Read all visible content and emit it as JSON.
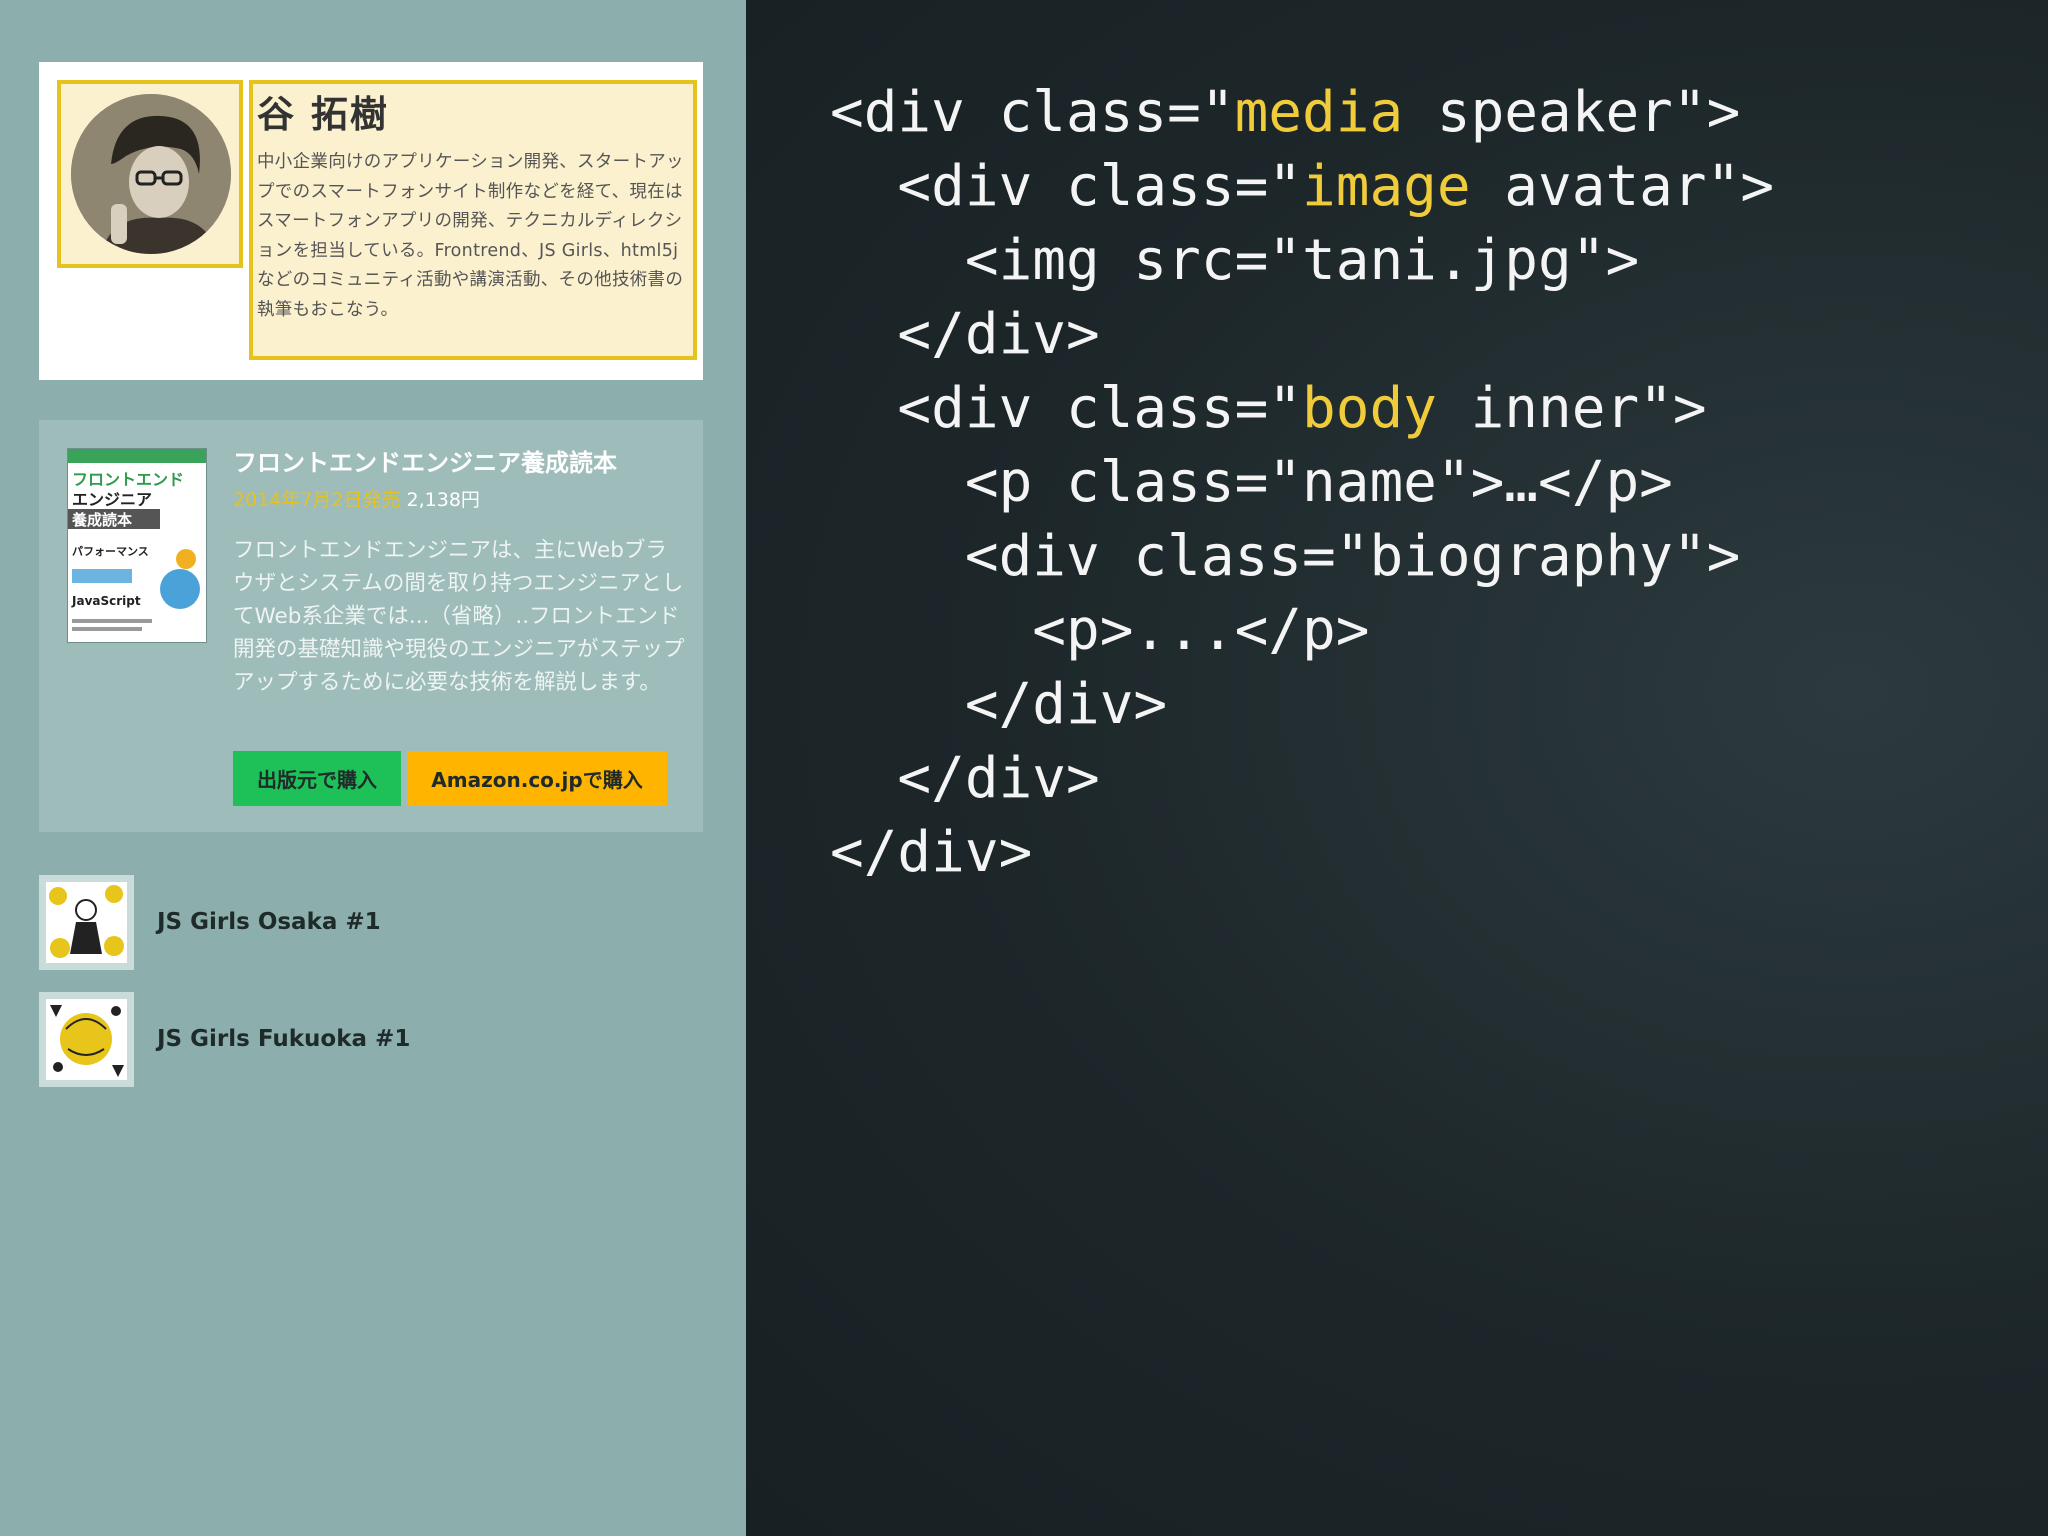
{
  "speaker": {
    "name": "谷 拓樹",
    "bio": "中小企業向けのアプリケーション開発、スタートアップでのスマートフォンサイト制作などを経て、現在はスマートフォンアプリの開発、テクニカルディレクションを担当している。Frontrend、JS Girls、html5jなどのコミュニティ活動や講演活動、その他技術書の執筆もおこなう。"
  },
  "book": {
    "title": "フロントエンドエンジニア養成読本",
    "date": "2014年7月2日発売",
    "price": "2,138円",
    "description": "フロントエンドエンジニアは、主にWebブラウザとシステムの間を取り持つエンジニアとしてWeb系企業では...（省略）..フロントエンド開発の基礎知識や現役のエンジニアがステップアップするために必要な技術を解説します。",
    "buy_publisher": "出版元で購入",
    "buy_amazon": "Amazon.co.jpで購入",
    "cover_text": {
      "main": "フロントエンド",
      "sub1": "エンジニア",
      "sub2": "養成読本",
      "perf": "パフォーマンス",
      "js": "JavaScript"
    }
  },
  "events": [
    {
      "label": "JS Girls Osaka #1"
    },
    {
      "label": "JS Girls Fukuoka #1"
    }
  ],
  "code": {
    "l1_a": "<div class=\"",
    "l1_hl": "media",
    "l1_b": " speaker\">",
    "l2_a": "  <div class=\"",
    "l2_hl": "image",
    "l2_b": " avatar\">",
    "l3": "    <img src=\"tani.jpg\">",
    "l4": "  </div>",
    "l5_a": "  <div class=\"",
    "l5_hl": "body",
    "l5_b": " inner\">",
    "l6": "    <p class=\"name\">…</p>",
    "l7": "    <div class=\"biography\">",
    "l8": "      <p>...</p>",
    "l9": "    </div>",
    "l10": "  </div>",
    "l11": "</div>"
  },
  "colors": {
    "sidebar_bg": "#8cafad",
    "highlight": "#f0cc3a",
    "frame": "#e6c21c",
    "publisher_button": "#1ec158",
    "amazon_button": "#ffb400",
    "code_bg": "#1c2629"
  }
}
